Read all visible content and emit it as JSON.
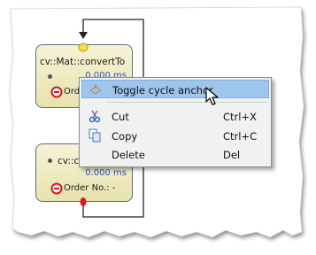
{
  "nodes": {
    "top": {
      "title": "cv::Mat::convertTo",
      "time": "0.000 ms",
      "order": "Ord"
    },
    "bottom": {
      "title": "cv::cv",
      "time": "0.000 ms",
      "order": "Order No.: -"
    }
  },
  "context_menu": {
    "items": [
      {
        "label": "Toggle cycle anchor",
        "shortcut": "",
        "icon": "cycle-anchor-icon"
      },
      {
        "label": "Cut",
        "shortcut": "Ctrl+X",
        "icon": "scissors-icon"
      },
      {
        "label": "Copy",
        "shortcut": "Ctrl+C",
        "icon": "copy-icon"
      },
      {
        "label": "Delete",
        "shortcut": "Del",
        "icon": ""
      }
    ]
  },
  "colors": {
    "node_fill": "#ece6b8",
    "node_border": "#5a6b8c",
    "time_text": "#2a55c8",
    "menu_highlight": "#9ec5ec",
    "anchor_port": "#f4e04a",
    "stop_port": "#e0181e"
  }
}
